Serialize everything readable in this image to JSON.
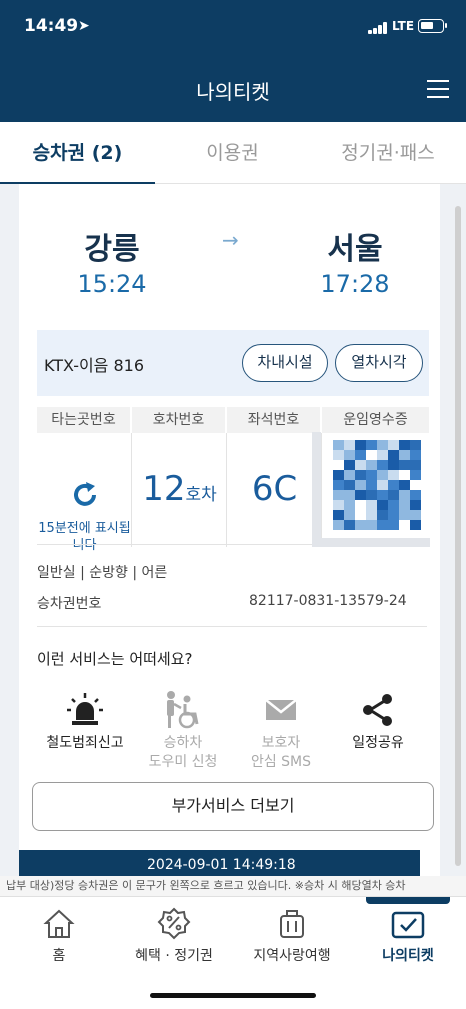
{
  "status": {
    "time": "14:49",
    "network": "LTE"
  },
  "header": {
    "title": "나의티켓"
  },
  "tabs": [
    {
      "label": "승차권 (2)"
    },
    {
      "label": "이용권"
    },
    {
      "label": "정기권·패스"
    }
  ],
  "ticket": {
    "from_station": "강릉",
    "from_time": "15:24",
    "to_station": "서울",
    "to_time": "17:28",
    "train_name": "KTX-이음 816",
    "facility_button": "차내시설",
    "timetable_button": "열차시각",
    "grid": {
      "headers": [
        "타는곳번호",
        "호차번호",
        "좌석번호",
        "운임영수증"
      ],
      "platform_note": "15분전에 표시됩니다",
      "car_number": "12",
      "car_unit": "호차",
      "seat": "6C"
    },
    "ticket_type": "일반실 | 순방향 | 어른",
    "ticket_no_label": "승차권번호",
    "ticket_no": "82117-0831-13579-24"
  },
  "services": {
    "title": "이런 서비스는 어떠세요?",
    "items": [
      {
        "icon": "siren-icon",
        "line1": "철도범죄신고",
        "line2": ""
      },
      {
        "icon": "wheelchair-assist-icon",
        "line1": "승하차",
        "line2": "도우미 신청"
      },
      {
        "icon": "mail-icon",
        "line1": "보호자",
        "line2": "안심 SMS"
      },
      {
        "icon": "share-icon",
        "line1": "일정공유",
        "line2": ""
      }
    ],
    "more_button": "부가서비스 더보기"
  },
  "bottom_strip": "2024-09-01 14:49:18",
  "ticker": "납부 대상)정당 승차권은 이 문구가 왼쪽으로 흐르고 있습니다. ※승차 시 해당열차 승차",
  "nav": [
    {
      "label": "홈",
      "icon": "home-icon"
    },
    {
      "label": "혜택 · 정기권",
      "icon": "discount-icon"
    },
    {
      "label": "지역사랑여행",
      "icon": "luggage-icon"
    },
    {
      "label": "나의티켓",
      "icon": "ticket-check-icon"
    }
  ],
  "colors": {
    "brand": "#0d3d63",
    "accent": "#1a6aa8"
  }
}
